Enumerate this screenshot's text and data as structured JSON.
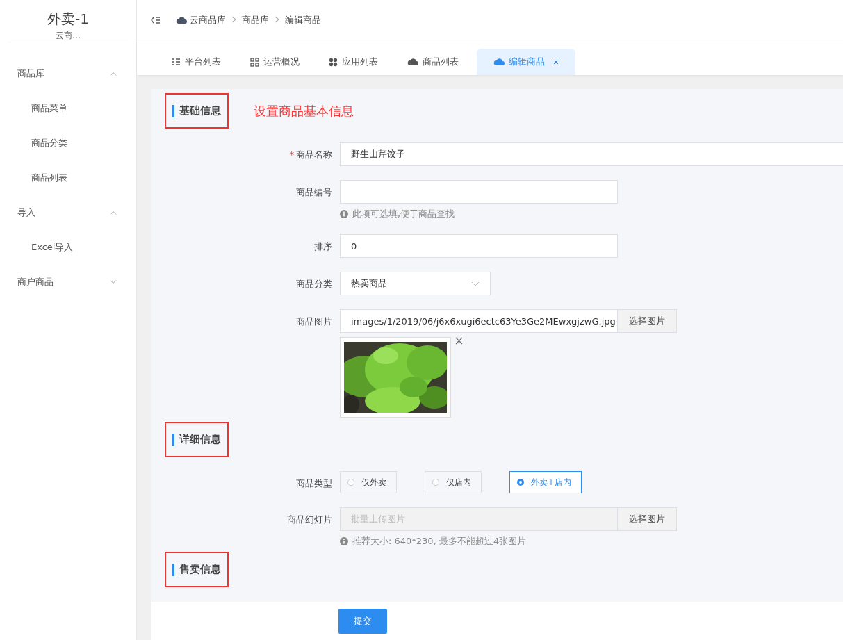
{
  "sidebar": {
    "title": "外卖-1",
    "subtitle": "云商…",
    "items": [
      {
        "label": "商品库",
        "expanded": true,
        "children": [
          {
            "label": "商品菜单"
          },
          {
            "label": "商品分类"
          },
          {
            "label": "商品列表"
          }
        ]
      },
      {
        "label": "导入",
        "expanded": true,
        "children": [
          {
            "label": "Excel导入"
          }
        ]
      },
      {
        "label": "商户商品",
        "expanded": false
      }
    ]
  },
  "breadcrumb": [
    "云商品库",
    "商品库",
    "编辑商品"
  ],
  "tabs": [
    {
      "label": "平台列表",
      "selected": false
    },
    {
      "label": "运营概况",
      "selected": false
    },
    {
      "label": "应用列表",
      "selected": false
    },
    {
      "label": "商品列表",
      "selected": false
    },
    {
      "label": "编辑商品",
      "selected": true
    }
  ],
  "sections": [
    {
      "title": "基础信息",
      "highlighted": true,
      "note": "设置商品基本信息",
      "fields": [
        {
          "kind": "text",
          "label": "商品名称",
          "required_mark": "*",
          "value": "野生山芹饺子"
        },
        {
          "kind": "text",
          "label": "商品编号",
          "hint": "此项可选填,便于商品查找"
        },
        {
          "kind": "text",
          "label": "排序",
          "value": "0"
        },
        {
          "kind": "select",
          "label": "商品分类",
          "value": "热卖商品"
        },
        {
          "label": "商品图片",
          "value": "images/1/2019/06/j6x6xugi6ectc63Ye3Ge2MEwxgjzwG.jpg",
          "button": "选择图片"
        }
      ]
    },
    {
      "title": "详细信息",
      "highlighted": true,
      "fields": [
        {
          "kind": "radio",
          "label": "商品类型",
          "options": [
            {
              "label": "仅外卖",
              "selected": false
            },
            {
              "label": "仅店内",
              "selected": false
            },
            {
              "label": "外卖+店内",
              "selected": true
            }
          ]
        },
        {
          "kind": "upload",
          "label": "商品幻灯片",
          "placeholder": "批量上传图片",
          "button": "选择图片",
          "hint": "推荐大小: 640*230, 最多不能超过4张图片"
        }
      ]
    },
    {
      "title": "售卖信息",
      "highlighted": true
    }
  ],
  "submit": "提交"
}
